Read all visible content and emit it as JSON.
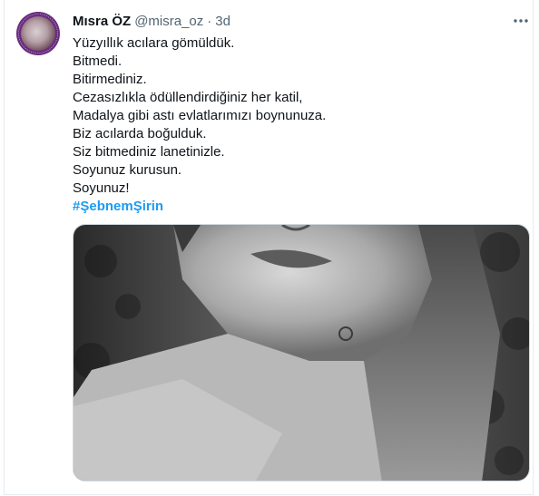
{
  "tweet": {
    "author_name": "Mısra ÖZ",
    "author_handle": "@misra_oz",
    "separator": "·",
    "time": "3d",
    "lines": [
      "Yüzyıllık acılara gömüldük.",
      "Bitmedi.",
      "Bitirmediniz.",
      "Cezasızlıkla ödüllendirdiğiniz her katil,",
      "Madalya gibi astı evlatlarımızı boynunuza.",
      "Biz acılarda boğulduk.",
      "Siz bitmediniz lanetinizle.",
      "Soyunuz kurusun.",
      "Soyunuz!"
    ],
    "hashtag": "#ŞebnemŞirin",
    "media_alt": "Black and white photo of a woman",
    "icons": {
      "more": "more-horizontal-icon",
      "avatar": "profile-avatar"
    },
    "colors": {
      "hashtag": "#1d9bf0",
      "secondary_text": "#536471",
      "avatar_ring": "#6a2c7f"
    }
  }
}
